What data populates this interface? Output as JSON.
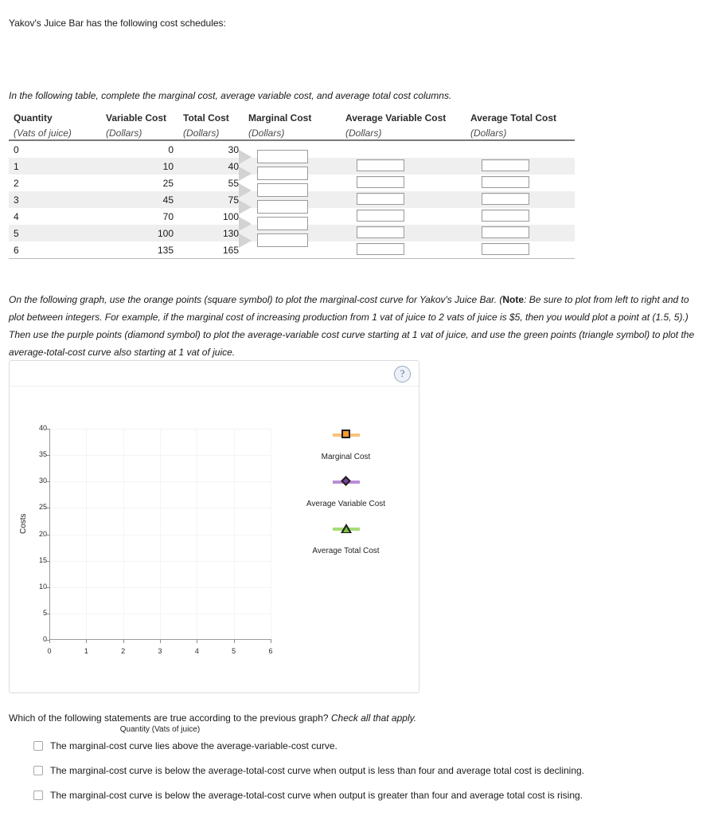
{
  "intro": {
    "line": "Yakov's Juice Bar has the following cost schedules:",
    "table_instruction": "In the following table, complete the marginal cost, average variable cost, and average total cost columns."
  },
  "table": {
    "columns": [
      {
        "title": "Quantity",
        "unit": "(Vats of juice)"
      },
      {
        "title": "Variable Cost",
        "unit": "(Dollars)"
      },
      {
        "title": "Total Cost",
        "unit": "(Dollars)"
      },
      {
        "title": "Marginal Cost",
        "unit": "(Dollars)"
      },
      {
        "title": "Average Variable Cost",
        "unit": "(Dollars)"
      },
      {
        "title": "Average Total Cost",
        "unit": "(Dollars)"
      }
    ],
    "rows": [
      {
        "quantity": "0",
        "variable_cost": "0",
        "total_cost": "30",
        "avc_value": "",
        "atc_value": "",
        "has_inputs": false
      },
      {
        "quantity": "1",
        "variable_cost": "10",
        "total_cost": "40",
        "avc_value": "",
        "atc_value": "",
        "has_inputs": true
      },
      {
        "quantity": "2",
        "variable_cost": "25",
        "total_cost": "55",
        "avc_value": "",
        "atc_value": "",
        "has_inputs": true
      },
      {
        "quantity": "3",
        "variable_cost": "45",
        "total_cost": "75",
        "avc_value": "",
        "atc_value": "",
        "has_inputs": true
      },
      {
        "quantity": "4",
        "variable_cost": "70",
        "total_cost": "100",
        "avc_value": "",
        "atc_value": "",
        "has_inputs": true
      },
      {
        "quantity": "5",
        "variable_cost": "100",
        "total_cost": "130",
        "avc_value": "",
        "atc_value": "",
        "has_inputs": true
      },
      {
        "quantity": "6",
        "variable_cost": "135",
        "total_cost": "165",
        "avc_value": "",
        "atc_value": "",
        "has_inputs": true
      }
    ],
    "marginal_cost_inputs": [
      "",
      "",
      "",
      "",
      "",
      ""
    ]
  },
  "graph_instruction": {
    "part1": "On the following graph, use the orange points (square symbol) to plot the marginal-cost curve for Yakov's Juice Bar. (",
    "note_label": "Note",
    "part2": ": Be sure to plot from left to right and to plot between integers. For example, if the marginal cost of increasing production from 1 vat of juice to 2 vats of juice is $5, then you would plot a point at (1.5, 5).) Then use the purple points (diamond symbol) to plot the average-variable cost curve starting at 1 vat of juice, and use the green points (triangle symbol) to plot the average-total-cost curve also starting at 1 vat of juice."
  },
  "graph": {
    "help_label": "?",
    "legend": [
      {
        "label": "Marginal Cost",
        "symbol": "square",
        "color": "#f59b2e",
        "line_color": "#f9c27d"
      },
      {
        "label": "Average Variable Cost",
        "symbol": "diamond",
        "color": "#7b3fa0",
        "line_color": "#b98ed6"
      },
      {
        "label": "Average Total Cost",
        "symbol": "triangle",
        "color": "#7cc242",
        "line_color": "#a6dd78"
      }
    ]
  },
  "chart_data": {
    "type": "scatter",
    "title": "",
    "xlabel": "Quantity (Vats of juice)",
    "ylabel": "Costs",
    "xlim": [
      0,
      6
    ],
    "ylim": [
      0,
      40
    ],
    "xticks": [
      "0",
      "1",
      "2",
      "3",
      "4",
      "5",
      "6"
    ],
    "yticks": [
      "0",
      "5",
      "10",
      "15",
      "20",
      "25",
      "30",
      "35",
      "40"
    ],
    "grid": true,
    "legend_position": "right",
    "series": [
      {
        "name": "Marginal Cost",
        "symbol": "square",
        "color": "#f59b2e",
        "x": [],
        "y": []
      },
      {
        "name": "Average Variable Cost",
        "symbol": "diamond",
        "color": "#7b3fa0",
        "x": [],
        "y": []
      },
      {
        "name": "Average Total Cost",
        "symbol": "triangle",
        "color": "#7cc242",
        "x": [],
        "y": []
      }
    ]
  },
  "questions": {
    "prompt_main": "Which of the following statements are true according to the previous graph? ",
    "prompt_italic": "Check all that apply.",
    "choices": [
      {
        "label": "The marginal-cost curve lies above the average-variable-cost curve.",
        "checked": false
      },
      {
        "label": "The marginal-cost curve is below the average-total-cost curve when output is less than four and average total cost is declining.",
        "checked": false
      },
      {
        "label": "The marginal-cost curve is below the average-total-cost curve when output is greater than four and average total cost is rising.",
        "checked": false
      }
    ]
  }
}
